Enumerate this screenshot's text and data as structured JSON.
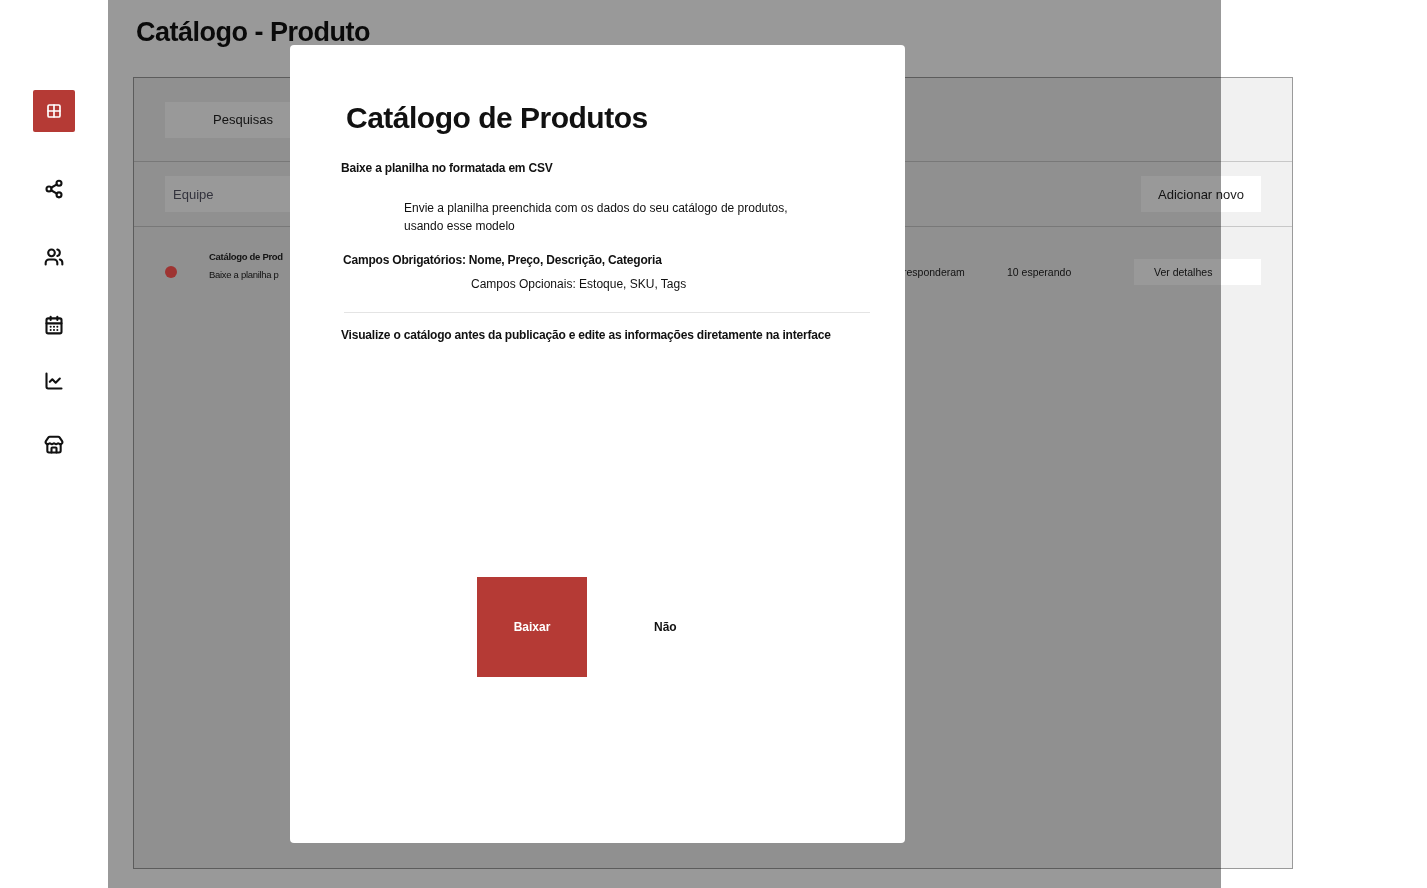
{
  "sidebar": {
    "items": [
      {
        "selected": true
      },
      {
        "selected": false
      },
      {
        "selected": false
      },
      {
        "selected": false
      },
      {
        "selected": false
      },
      {
        "selected": false
      }
    ]
  },
  "page_title": "Catálogo - Produto",
  "toolbar": {
    "tab": "Pesquisas"
  },
  "filter": {
    "placeholder": "Equipe",
    "add_button": "Adicionar novo"
  },
  "rows": [
    {
      "title": "Catálogo de Prod",
      "subtitle": "Baixe a planilha p",
      "color": "#9e3432",
      "responded": "responderam",
      "waiting": "10 esperando",
      "action": "Ver detalhes"
    }
  ],
  "modal": {
    "title": "Catálogo de Produtos",
    "download_note": "Baixe a planilha no formatada em CSV",
    "instructions": "Envie a planilha preenchida com os dados do seu catálogo de produtos, usando esse modelo",
    "required": "Campos Obrigatórios: Nome, Preço, Descrição, Categoria",
    "optional": "Campos Opcionais: Estoque, SKU, Tags",
    "preview_note": "Visualize o catálogo antes da publicação e edite as informações diretamente na interface",
    "confirm": "Baixar",
    "cancel": "Não"
  }
}
